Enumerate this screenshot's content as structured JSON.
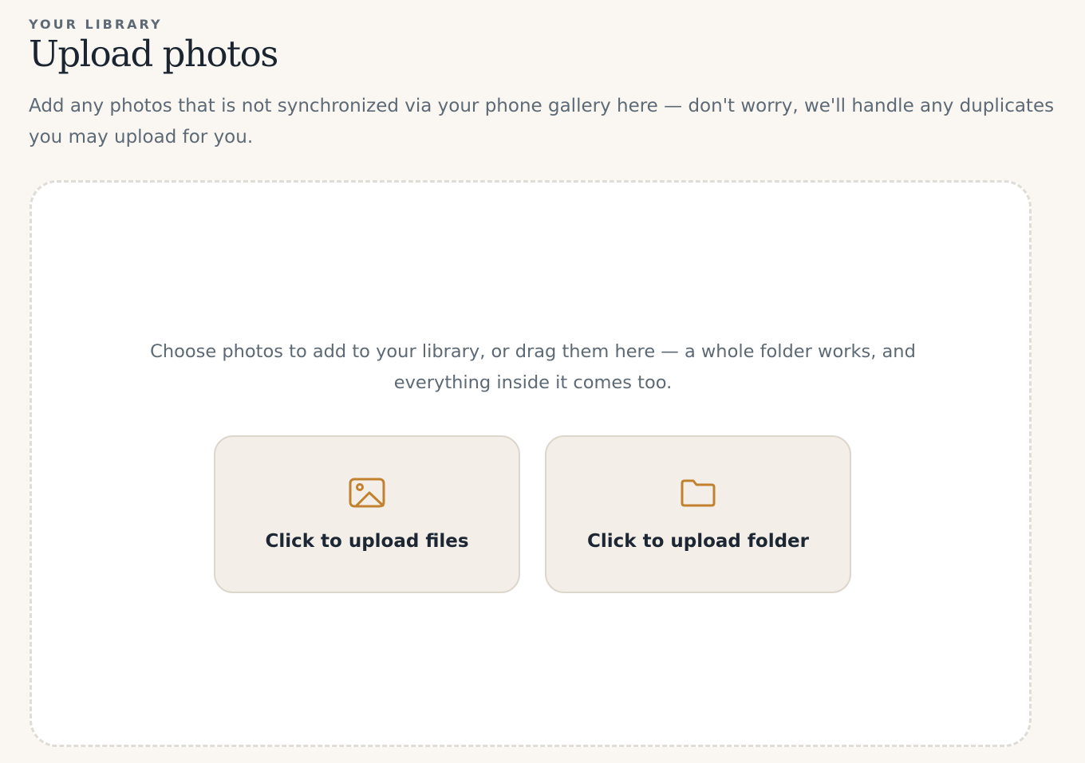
{
  "header": {
    "eyebrow": "YOUR LIBRARY",
    "title": "Upload photos",
    "description": "Add any photos that is not synchronized via your phone gallery here — don't worry, we'll handle any duplicates you may upload for you."
  },
  "dropzone": {
    "instruction": "Choose photos to add to your library, or drag them here — a whole folder works, and everything inside it comes too.",
    "buttons": [
      {
        "label": "Click to upload files",
        "icon": "image-icon"
      },
      {
        "label": "Click to upload folder",
        "icon": "folder-icon"
      }
    ]
  },
  "colors": {
    "background": "#faf7f2",
    "accent": "#c1812f",
    "button_background": "#f3eee7",
    "dropzone_border": "#e0dcd6",
    "muted_text": "#5d6a76",
    "heading_text": "#1a2531"
  }
}
